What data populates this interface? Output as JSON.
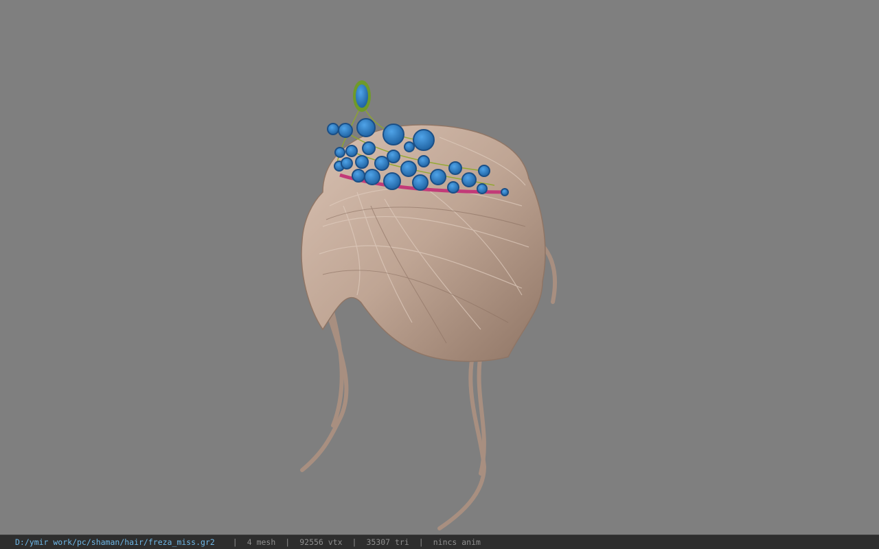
{
  "viewport": {
    "background_color": "#7f7f7f",
    "model": {
      "hair_color": "#bfa594",
      "gem_color": "#2a7cc4",
      "gem_rim_color": "#6f9a2a",
      "band_color": "#c23a78"
    }
  },
  "statusbar": {
    "file_path": "D:/ymir work/pc/shaman/hair/freza_miss.gr2",
    "separator": "|",
    "mesh_count": "4 mesh",
    "vertex_count": "92556 vtx",
    "triangle_count": "35307 tri",
    "anim_status": "nincs anim"
  }
}
